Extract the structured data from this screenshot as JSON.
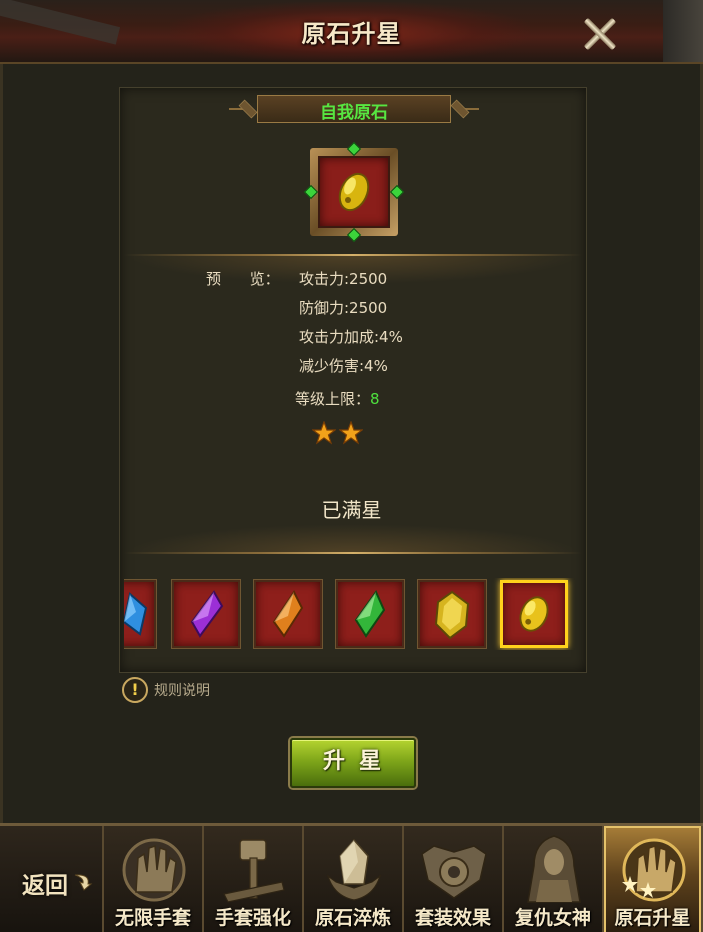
{
  "header": {
    "title": "原石升星"
  },
  "stone": {
    "name": "自我原石"
  },
  "preview": {
    "label": "预      览：",
    "stats": [
      "攻击力:2500",
      "防御力:2500",
      "攻击力加成:4%",
      "减少伤害:4%"
    ],
    "level_cap_label": "等级上限：",
    "level_cap_value": "8",
    "stars": 2
  },
  "status_text": "已满星",
  "gems": [
    {
      "name": "blue-gem",
      "color": "#2f8fe0",
      "partial": true
    },
    {
      "name": "purple-gem",
      "color": "#9b2fd6"
    },
    {
      "name": "orange-gem",
      "color": "#e0801d"
    },
    {
      "name": "green-gem",
      "color": "#33b63a"
    },
    {
      "name": "gold-gem",
      "color": "#d6b41f"
    },
    {
      "name": "self-stone-gem",
      "color": "#e8c21c",
      "selected": true
    }
  ],
  "rules": {
    "label": "规则说明"
  },
  "upgrade_button": {
    "label": "升星"
  },
  "nav": {
    "back_label": "返回",
    "tabs": [
      {
        "label": "无限手套",
        "icon": "gauntlet-icon",
        "active": false
      },
      {
        "label": "手套强化",
        "icon": "hammer-icon",
        "active": false
      },
      {
        "label": "原石淬炼",
        "icon": "crystal-icon",
        "active": false
      },
      {
        "label": "套装效果",
        "icon": "crest-icon",
        "active": false
      },
      {
        "label": "复仇女神",
        "icon": "goddess-icon",
        "active": false
      },
      {
        "label": "原石升星",
        "icon": "gauntlet-stars-icon",
        "active": true
      }
    ]
  },
  "colors": {
    "accent_green": "#4ee03e",
    "selected_border": "#ffd21c",
    "button_green": "#7fa61a"
  }
}
